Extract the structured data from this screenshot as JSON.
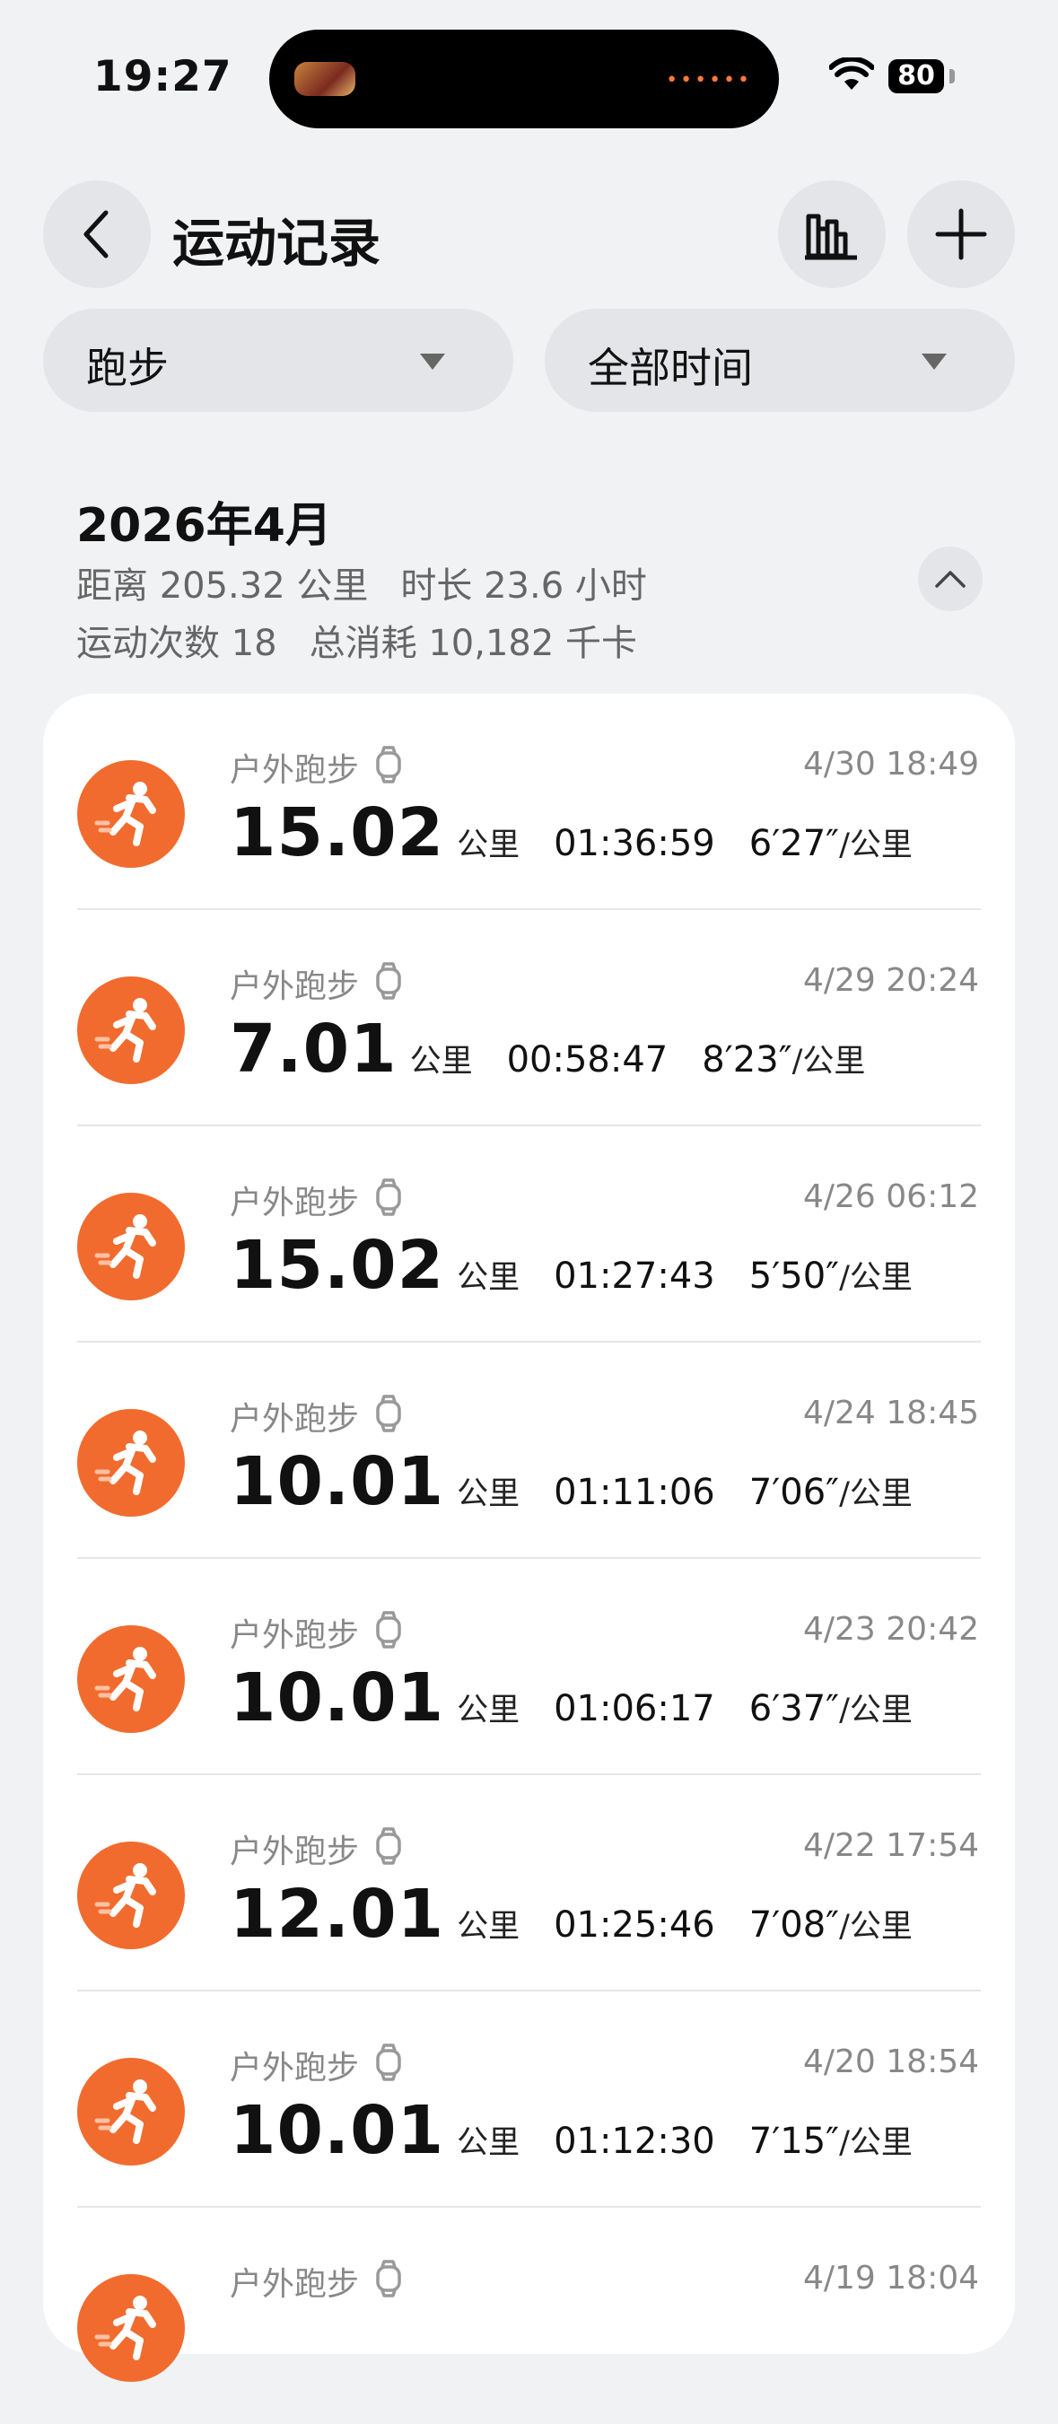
{
  "status_bar": {
    "time": "19:27",
    "battery": "80"
  },
  "header": {
    "title": "运动记录"
  },
  "filters": {
    "sport": "跑步",
    "time_range": "全部时间"
  },
  "summary": {
    "month": "2026年4月",
    "distance": "距离 205.32 公里",
    "duration": "时长 23.6 小时",
    "count": "运动次数 18",
    "calories": "总消耗 10,182 千卡"
  },
  "records": [
    {
      "type": "户外跑步",
      "date": "4/30 18:49",
      "distance": "15.02",
      "unit": "公里",
      "duration": "01:36:59",
      "pace": "6′27″",
      "pace_unit": "/公里"
    },
    {
      "type": "户外跑步",
      "date": "4/29 20:24",
      "distance": "7.01",
      "unit": "公里",
      "duration": "00:58:47",
      "pace": "8′23″",
      "pace_unit": "/公里"
    },
    {
      "type": "户外跑步",
      "date": "4/26 06:12",
      "distance": "15.02",
      "unit": "公里",
      "duration": "01:27:43",
      "pace": "5′50″",
      "pace_unit": "/公里"
    },
    {
      "type": "户外跑步",
      "date": "4/24 18:45",
      "distance": "10.01",
      "unit": "公里",
      "duration": "01:11:06",
      "pace": "7′06″",
      "pace_unit": "/公里"
    },
    {
      "type": "户外跑步",
      "date": "4/23 20:42",
      "distance": "10.01",
      "unit": "公里",
      "duration": "01:06:17",
      "pace": "6′37″",
      "pace_unit": "/公里"
    },
    {
      "type": "户外跑步",
      "date": "4/22 17:54",
      "distance": "12.01",
      "unit": "公里",
      "duration": "01:25:46",
      "pace": "7′08″",
      "pace_unit": "/公里"
    },
    {
      "type": "户外跑步",
      "date": "4/20 18:54",
      "distance": "10.01",
      "unit": "公里",
      "duration": "01:12:30",
      "pace": "7′15″",
      "pace_unit": "/公里"
    },
    {
      "type": "户外跑步",
      "date": "4/19 18:04"
    }
  ],
  "colors": {
    "accent": "#F26B2E",
    "background": "#F1F2F4"
  },
  "icons": {
    "back": "chevron-left-icon",
    "stats": "bar-chart-icon",
    "add": "plus-icon",
    "run": "running-person-icon",
    "watch": "watch-icon",
    "collapse": "chevron-up-icon"
  }
}
